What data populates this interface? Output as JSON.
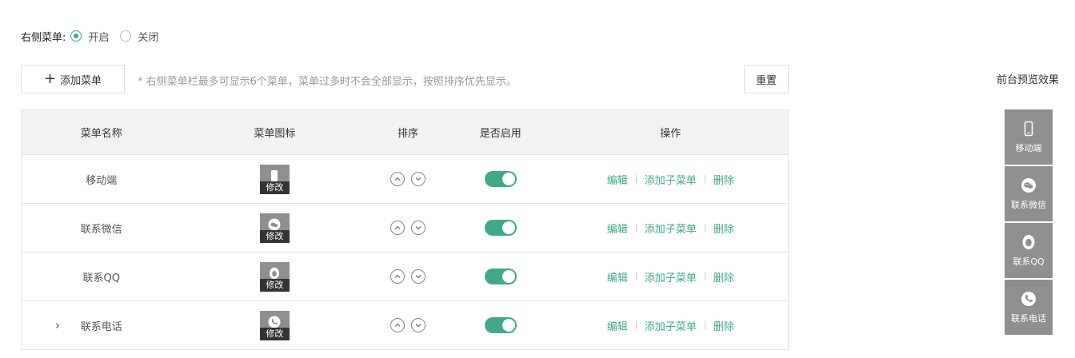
{
  "sidebar_menu": {
    "label": "右侧菜单:",
    "options": [
      {
        "label": "开启",
        "selected": true
      },
      {
        "label": "关闭",
        "selected": false
      }
    ]
  },
  "toolbar": {
    "add_label": "添加菜单",
    "hint": "* 右侧菜单栏最多可显示6个菜单，菜单过多时不会全部显示，按照排序优先显示。",
    "reset_label": "重置"
  },
  "table": {
    "headers": [
      "菜单名称",
      "菜单图标",
      "排序",
      "是否启用",
      "操作"
    ],
    "edit_icon_label": "修改",
    "actions": {
      "edit": "编辑",
      "add_sub": "添加子菜单",
      "delete": "删除"
    },
    "rows": [
      {
        "name": "移动端",
        "icon": "mobile-icon",
        "enabled": true,
        "expandable": false
      },
      {
        "name": "联系微信",
        "icon": "wechat-icon",
        "enabled": true,
        "expandable": false
      },
      {
        "name": "联系QQ",
        "icon": "qq-icon",
        "enabled": true,
        "expandable": false
      },
      {
        "name": "联系电话",
        "icon": "phone-icon",
        "enabled": true,
        "expandable": true
      }
    ]
  },
  "preview": {
    "title": "前台预览效果",
    "items": [
      {
        "label": "移动端",
        "icon": "mobile-icon"
      },
      {
        "label": "联系微信",
        "icon": "wechat-icon"
      },
      {
        "label": "联系QQ",
        "icon": "qq-icon"
      },
      {
        "label": "联系电话",
        "icon": "phone-icon"
      }
    ]
  },
  "colors": {
    "accent": "#40a98a",
    "icon_bg": "#8f8f8f",
    "header_bg": "#f2f2f2"
  }
}
